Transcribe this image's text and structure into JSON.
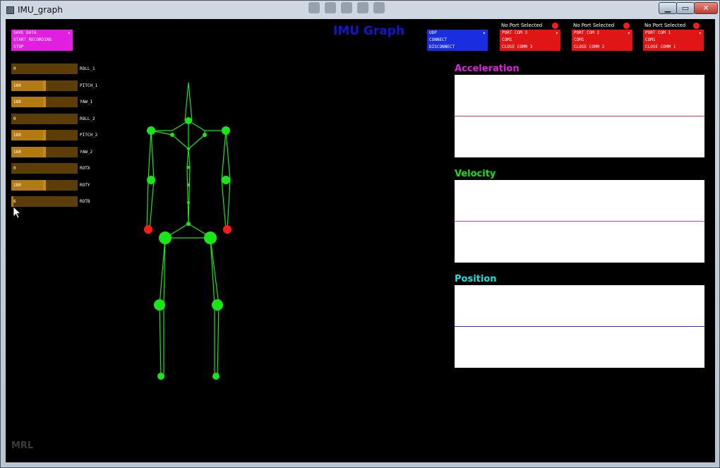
{
  "window": {
    "title": "IMU_graph"
  },
  "app": {
    "title": "IMU Graph",
    "footer": "MRL"
  },
  "recording": {
    "save_data": "SAVE DATA",
    "start_recording": "START RECORDING",
    "stop": "STOP"
  },
  "network": {
    "protocol": "UDP",
    "connect": "CONNECT",
    "disconnect": "DISCONNECT"
  },
  "ports": [
    {
      "status": "No Port Selected",
      "port": "PORT COM 3",
      "com": "COM1",
      "close": "CLOSE COMM 3"
    },
    {
      "status": "No Port Selected",
      "port": "PORT COM 2",
      "com": "COM1",
      "close": "CLOSE COMM 2"
    },
    {
      "status": "No Port Selected",
      "port": "PORT COM 1",
      "com": "COM1",
      "close": "CLOSE COMM 1"
    }
  ],
  "sliders": [
    {
      "label": "ROLL_1",
      "value": "0",
      "fraction": 0.0
    },
    {
      "label": "PITCH_1",
      "value": "180",
      "fraction": 0.5
    },
    {
      "label": "YAW_1",
      "value": "180",
      "fraction": 0.5
    },
    {
      "label": "ROLL_2",
      "value": "0",
      "fraction": 0.0
    },
    {
      "label": "PITCH_2",
      "value": "180",
      "fraction": 0.5
    },
    {
      "label": "YAW_2",
      "value": "180",
      "fraction": 0.5
    },
    {
      "label": "ROTX",
      "value": "0",
      "fraction": 0.0
    },
    {
      "label": "ROTY",
      "value": "180",
      "fraction": 0.5
    },
    {
      "label": "ROTB",
      "value": "6",
      "fraction": 0.03
    }
  ],
  "graphs": [
    {
      "title": "Acceleration",
      "title_color": "#e020e0",
      "line_color": "#e04040"
    },
    {
      "title": "Velocity",
      "title_color": "#19e019",
      "line_color": "#e040e0"
    },
    {
      "title": "Position",
      "title_color": "#19e0e0",
      "line_color": "#3030e0"
    }
  ],
  "skeleton": {
    "color": "#19e619",
    "hand_color": "#ff1a1a"
  }
}
